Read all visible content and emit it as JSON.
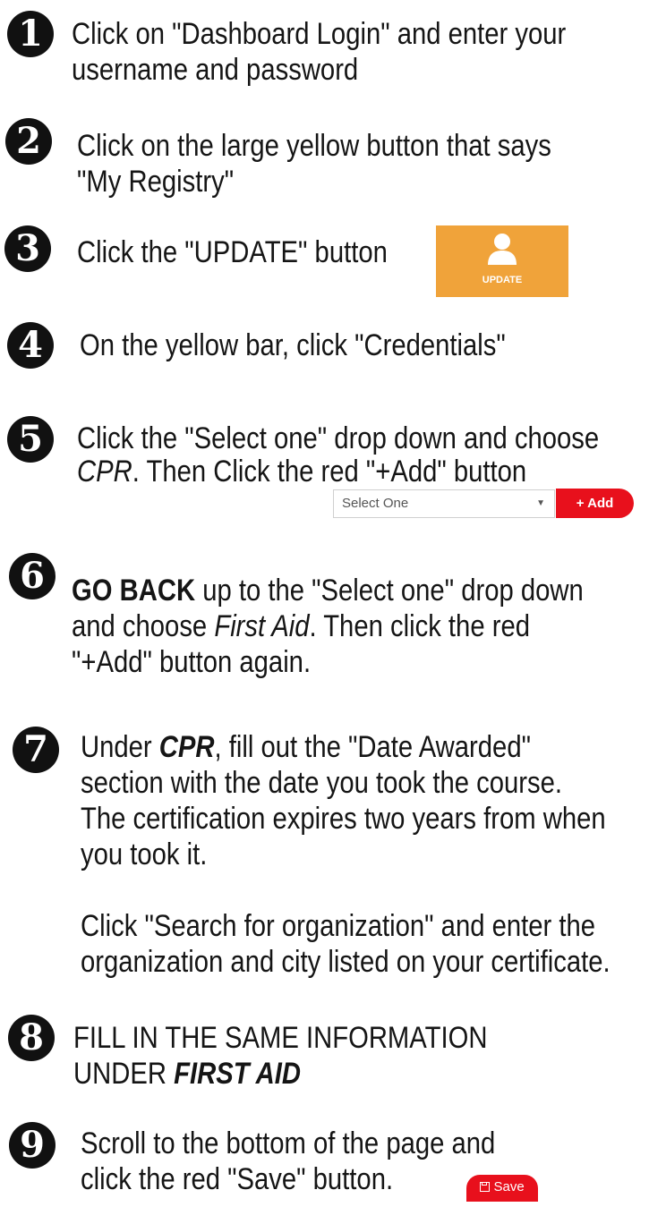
{
  "steps": [
    {
      "number": "1",
      "line1": "Click on \"Dashboard Login\" and enter your",
      "line2": "username and password"
    },
    {
      "number": "2",
      "line1": "Click on the large yellow button that says",
      "line2": "\"My Registry\""
    },
    {
      "number": "3",
      "line1": "Click the \"UPDATE\" button"
    },
    {
      "number": "4",
      "line1": "On the yellow bar, click \"Credentials\""
    },
    {
      "number": "5",
      "line1": "Click the \"Select one\" drop down and choose",
      "line2_em": "CPR",
      "line2_rest": ". Then Click the red \"+Add\" button"
    },
    {
      "number": "6",
      "line1_bold": "GO BACK",
      "line1_rest": " up to the \"Select one\" drop down",
      "line2_a": "and choose ",
      "line2_em": "First Aid",
      "line2_rest": ". Then click the red",
      "line3": "\"+Add\" button again."
    },
    {
      "number": "7",
      "line1_a": "Under ",
      "line1_bold": "CPR",
      "line1_rest": ", fill out the \"Date Awarded\"",
      "line2": "section with the date you took the course.",
      "line3": "The certification expires two years from when",
      "line4": "you took it.",
      "line5": "Click \"Search for organization\" and enter the",
      "line6": "organization and city listed on your certificate."
    },
    {
      "number": "8",
      "line1": "FILL IN THE SAME INFORMATION",
      "line2_a": "UNDER ",
      "line2_bold": "FIRST AID"
    },
    {
      "number": "9",
      "line1": "Scroll to the bottom of the page and",
      "line2": "click the red \"Save\" button."
    }
  ],
  "update_button": {
    "label": "UPDATE",
    "icon": "user-icon",
    "color": "#f0a33a"
  },
  "credential_select": {
    "selected": "Select One",
    "caret": "▼"
  },
  "add_button": {
    "label": "Add",
    "icon": "plus-icon",
    "color": "#e8101c"
  },
  "save_button": {
    "label": "Save",
    "icon": "floppy-disk-icon",
    "color": "#e8101c"
  }
}
